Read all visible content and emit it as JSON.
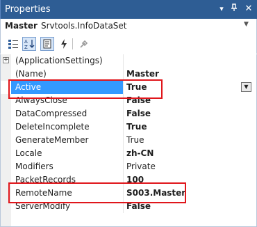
{
  "window": {
    "title": "Properties"
  },
  "object": {
    "name": "Master",
    "type": "Srvtools.InfoDataSet"
  },
  "toolbar": {
    "buttons": [
      {
        "name": "categorized-icon"
      },
      {
        "name": "alphabetical-icon"
      },
      {
        "name": "properties-icon"
      },
      {
        "name": "events-icon"
      },
      {
        "name": "property-pages-icon"
      }
    ]
  },
  "properties": [
    {
      "name": "(ApplicationSettings)",
      "value": ""
    },
    {
      "name": "(Name)",
      "value": "Master"
    },
    {
      "name": "Active",
      "value": "True"
    },
    {
      "name": "AlwaysClose",
      "value": "False"
    },
    {
      "name": "DataCompressed",
      "value": "False"
    },
    {
      "name": "DeleteIncomplete",
      "value": "True"
    },
    {
      "name": "GenerateMember",
      "value": "True"
    },
    {
      "name": "Locale",
      "value": "zh-CN"
    },
    {
      "name": "Modifiers",
      "value": "Private"
    },
    {
      "name": "PacketRecords",
      "value": "100"
    },
    {
      "name": "RemoteName",
      "value": "S003.Master"
    },
    {
      "name": "ServerModify",
      "value": "False"
    }
  ],
  "colors": {
    "title_bar": "#2e5d94",
    "selection": "#3399ff",
    "annotation": "#e0161b"
  }
}
